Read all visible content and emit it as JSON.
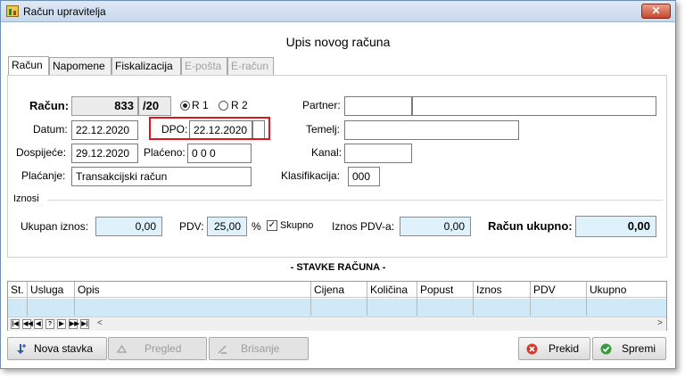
{
  "window": {
    "title": "Račun upravitelja",
    "close_glyph": "✕"
  },
  "heading": "Upis novog računa",
  "tabs": [
    {
      "label": "Račun",
      "state": "active"
    },
    {
      "label": "Napomene",
      "state": "normal"
    },
    {
      "label": "Fiskalizacija",
      "state": "normal"
    },
    {
      "label": "E-pošta",
      "state": "disabled"
    },
    {
      "label": "E-račun",
      "state": "disabled"
    }
  ],
  "form": {
    "racun_label": "Račun:",
    "racun_number": "833",
    "racun_suffix": "/20",
    "radio_r1": "R 1",
    "radio_r2": "R 2",
    "radio_selected": "R 1",
    "datum_label": "Datum:",
    "datum_value": "22.12.2020",
    "dpo_label": "DPO:",
    "dpo_value": "22.12.2020",
    "dospijece_label": "Dospijeće:",
    "dospijece_value": "29.12.2020",
    "placeno_label": "Plaćeno:",
    "placeno_value": "0 0 0",
    "placanje_label": "Plaćanje:",
    "placanje_value": "Transakcijski račun",
    "partner_label": "Partner:",
    "partner_code": "",
    "partner_name": "",
    "temelj_label": "Temelj:",
    "temelj_value": "",
    "kanal_label": "Kanal:",
    "kanal_value": "",
    "klasifikacija_label": "Klasifikacija:",
    "klasifikacija_value": "000"
  },
  "iznosi": {
    "section_label": "Iznosi",
    "ukupan_label": "Ukupan iznos:",
    "ukupan_value": "0,00",
    "pdv_label": "PDV:",
    "pdv_value": "25,00",
    "pdv_unit": "%",
    "skupno_label": "Skupno",
    "skupno_checked": true,
    "iznos_pdv_label": "Iznos PDV-a:",
    "iznos_pdv_value": "0,00",
    "racun_ukupno_label": "Račun ukupno:",
    "racun_ukupno_value": "0,00"
  },
  "stavke": {
    "title": "- STAVKE RAČUNA -",
    "columns": [
      "St.",
      "Usluga",
      "Opis",
      "Cijena",
      "Količina",
      "Popust",
      "Iznos",
      "PDV",
      "Ukupno"
    ],
    "nav": [
      "|◀",
      "◀◀",
      "◀",
      "?",
      "▶",
      "▶▶",
      "▶|"
    ],
    "scroll_left": "<",
    "scroll_right": ">"
  },
  "buttons": {
    "nova_stavka": "Nova stavka",
    "pregled": "Pregled",
    "brisanje": "Brisanje",
    "prekid": "Prekid",
    "spremi": "Spremi"
  },
  "colors": {
    "highlight_red": "#e0141e",
    "field_blue": "#dff2fb",
    "prekid_red": "#d43b2f",
    "spremi_green": "#3a9b3a"
  }
}
